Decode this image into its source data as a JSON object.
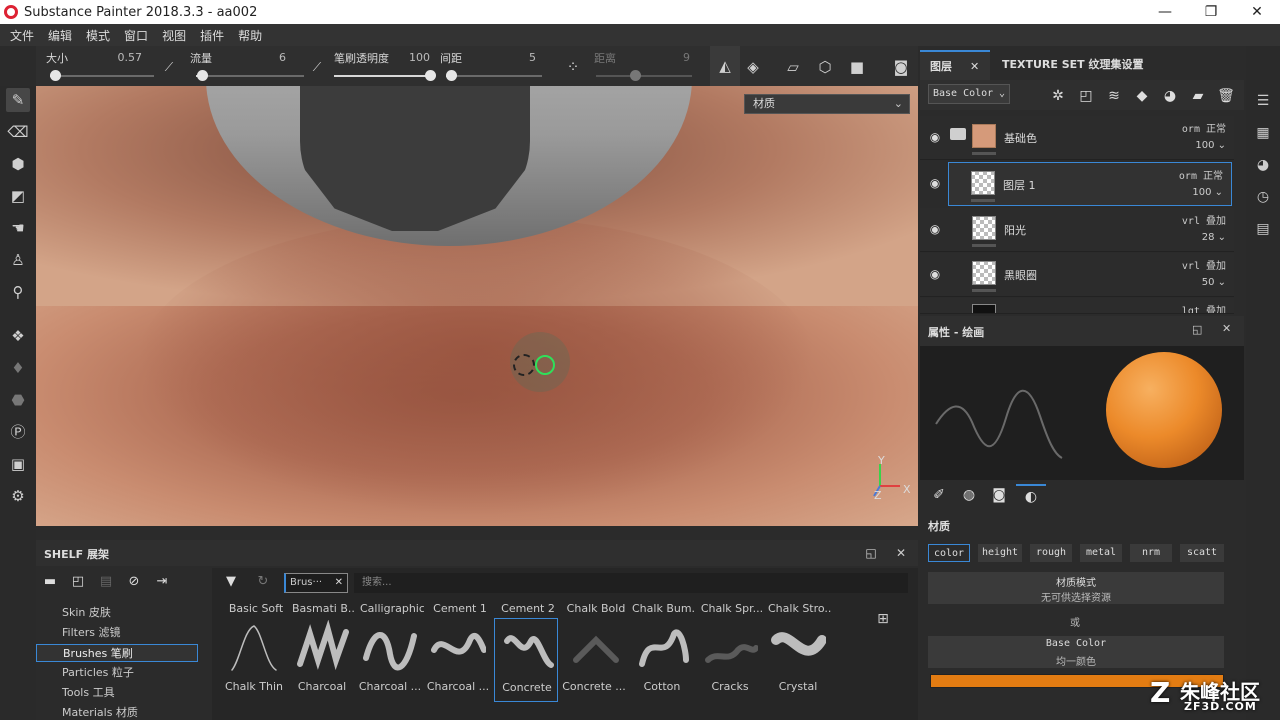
{
  "window": {
    "title": "Substance Painter 2018.3.3 - aa002",
    "minimize": "—",
    "maximize": "❐",
    "close": "✕"
  },
  "menu": [
    "文件",
    "编辑",
    "模式",
    "窗口",
    "视图",
    "插件",
    "帮助"
  ],
  "tool_options": {
    "size_label": "大小",
    "size_value": "0.57",
    "size_fraction": 0.05,
    "flow_label": "流量",
    "flow_value": "6",
    "flow_fraction": 0.06,
    "opacity_label": "笔刷透明度",
    "opacity_value": "100",
    "opacity_fraction": 1.0,
    "spacing_label": "间距",
    "spacing_value": "5",
    "spacing_fraction": 0.05,
    "distance_label": "距离",
    "distance_value": "9"
  },
  "viewport": {
    "material_select": "材质",
    "axis_y": "Y",
    "axis_x": "X",
    "axis_z": "Z"
  },
  "layers_panel": {
    "tab_layers": "图层",
    "tab_texture_set": "TEXTURE SET 纹理集设置",
    "channel": "Base Color",
    "layers": [
      {
        "name": "基础色",
        "blend": "orm 正常",
        "opacity": "100",
        "type": "folder"
      },
      {
        "name": "图层 1",
        "blend": "orm 正常",
        "opacity": "100",
        "type": "paint",
        "selected": true
      },
      {
        "name": "阳光",
        "blend": "vrl 叠加",
        "opacity": "28",
        "type": "paint"
      },
      {
        "name": "黑眼圈",
        "blend": "vrl 叠加",
        "opacity": "50",
        "type": "paint"
      }
    ],
    "partial_layer_blend": "lgt 叠加"
  },
  "properties_panel": {
    "title": "属性 - 绘画",
    "section_material": "材质",
    "channels": [
      "color",
      "height",
      "rough",
      "metal",
      "nrm",
      "scatt"
    ],
    "material_mode_label": "材质模式",
    "material_mode_value": "无可供选择资源",
    "or_text": "或",
    "base_color_label": "Base Color",
    "base_color_value": "均一颜色",
    "base_color_hex": "#e37c12"
  },
  "shelf": {
    "title": "SHELF 展架",
    "categories": [
      "Skin 皮肤",
      "Filters 滤镜",
      "Brushes 笔刷",
      "Particles 粒子",
      "Tools 工具",
      "Materials 材质"
    ],
    "active_category": "Brushes 笔刷",
    "filter_tag": "Brus···",
    "search_placeholder": "搜索...",
    "brushes_top": [
      "Basic Soft",
      "Basmati B...",
      "Calligraphic",
      "Cement 1",
      "Cement 2",
      "Chalk Bold",
      "Chalk Bum...",
      "Chalk Spr...",
      "Chalk Stro..."
    ],
    "brushes_bottom": [
      "Chalk Thin",
      "Charcoal",
      "Charcoal ...",
      "Charcoal ...",
      "Concrete",
      "Concrete ...",
      "Cotton",
      "Cracks",
      "Crystal"
    ],
    "selected_brush": "Concrete"
  },
  "watermark": {
    "main": "朱峰社区",
    "sub": "ZF3D.COM",
    "z": "Z"
  }
}
